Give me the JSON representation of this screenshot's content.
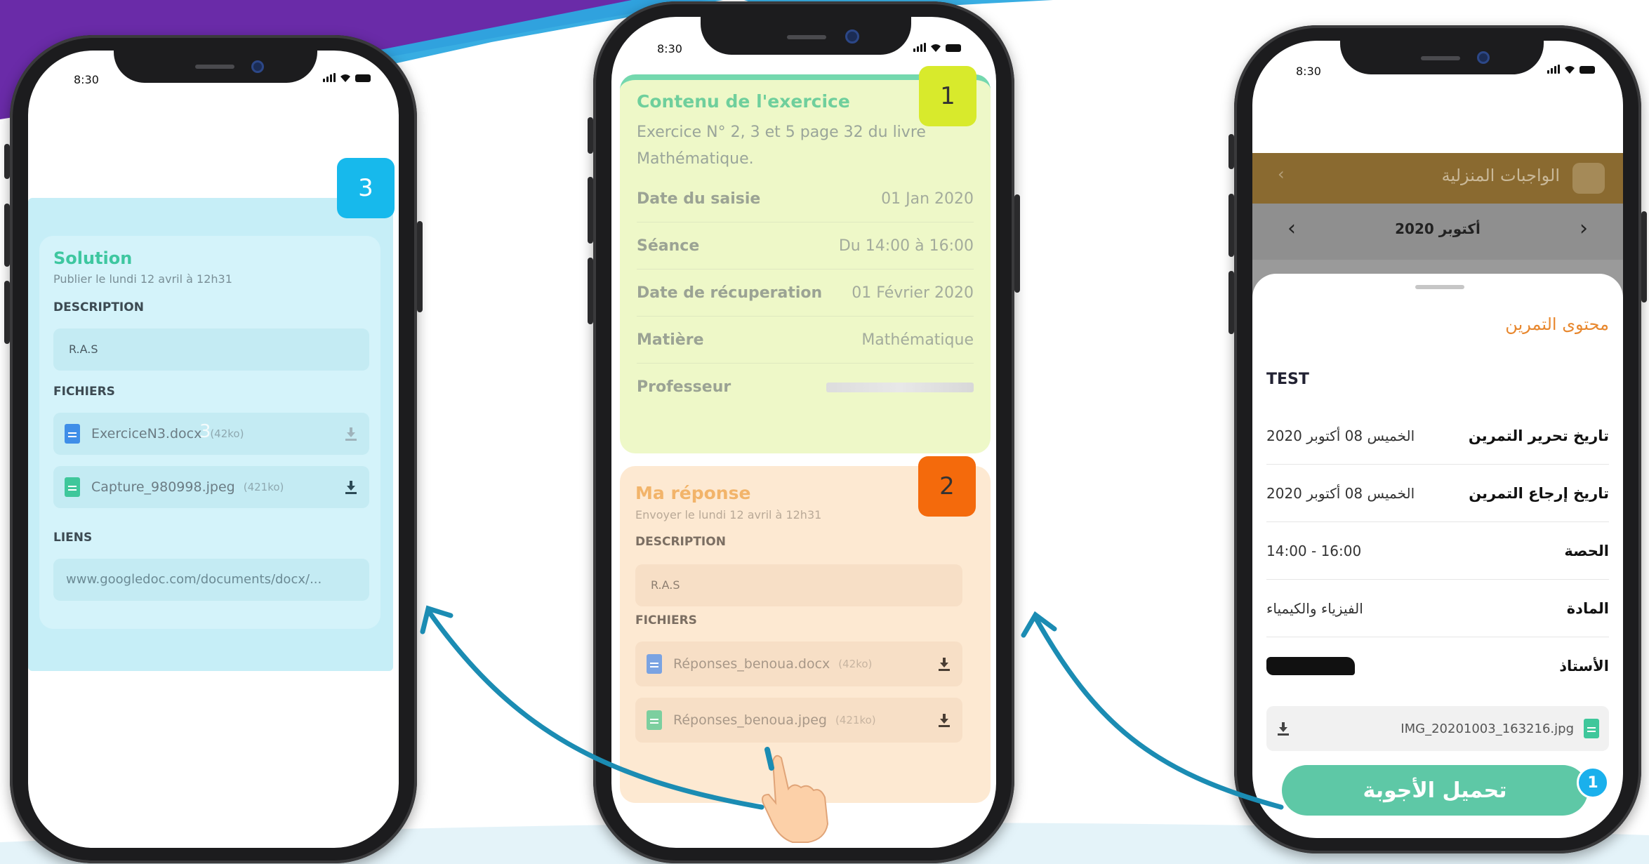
{
  "colors": {
    "purple": "#6a2ba8",
    "blue": "#2da9e0",
    "green_badge": "#d8ea2c",
    "orange_badge": "#f46a0c",
    "cyan_badge": "#17b9ec",
    "teal_button": "#5ec8a6",
    "arrow": "#1b8cb3",
    "orange_title": "#e8882f"
  },
  "phone_left": {
    "time": "8:30",
    "badge": "3",
    "solution_title": "Solution",
    "solution_sub": "Publier le lundi 12 avril à 12h31",
    "description_label": "DESCRIPTION",
    "description_value": "R.A.S",
    "files_label": "FICHIERS",
    "files": [
      {
        "name": "ExerciceN3.docx",
        "size": "(42ko)",
        "overlay": "3",
        "icon": "doc-icon"
      },
      {
        "name": "Capture_980998.jpeg",
        "size": "(421ko)",
        "icon": "image-icon"
      }
    ],
    "links_label": "LIENS",
    "link_value": "www.googledoc.com/documents/docx/..."
  },
  "phone_middle": {
    "time": "8:30",
    "badge1": "1",
    "badge2": "2",
    "exercise_title": "Contenu de l'exercice",
    "exercise_text": "Exercice N° 2, 3 et 5 page 32 du livre Mathématique.",
    "rows": [
      {
        "label": "Date du saisie",
        "value": "01 Jan 2020"
      },
      {
        "label": "Séance",
        "value": "Du 14:00 à 16:00"
      },
      {
        "label": "Date de récuperation",
        "value": "01 Février 2020"
      },
      {
        "label": "Matière",
        "value": "Mathématique"
      },
      {
        "label": "Professeur",
        "value": ""
      }
    ],
    "reply_title": "Ma réponse",
    "reply_sub": "Envoyer le lundi 12 avril à 12h31",
    "description_label": "DESCRIPTION",
    "description_value": "R.A.S",
    "files_label": "FICHIERS",
    "files": [
      {
        "name": "Réponses_benoua.docx",
        "size": "(42ko)",
        "icon": "doc-icon"
      },
      {
        "name": "Réponses_benoua.jpeg",
        "size": "(421ko)",
        "icon": "image-icon"
      }
    ]
  },
  "phone_right": {
    "time": "8:30",
    "header_title": "الواجبات المنزلية",
    "month": "أكتوبر 2020",
    "section_title": "محتوى التمرين",
    "test_label": "TEST",
    "rows": [
      {
        "label": "تاريخ تحرير التمرين",
        "value": "الخميس 08 أكتوبر 2020"
      },
      {
        "label": "تاريخ إرجاع التمرين",
        "value": "الخميس 08 أكتوبر 2020"
      },
      {
        "label": "الحصة",
        "value": "14:00 - 16:00"
      },
      {
        "label": "المادة",
        "value": "الفيزياء والكيمياء"
      },
      {
        "label": "الأستاذ",
        "value": ""
      }
    ],
    "file_name": "IMG_20201003_163216.jpg",
    "upload_button": "تحميل الأجوبة",
    "step_badge": "1"
  }
}
